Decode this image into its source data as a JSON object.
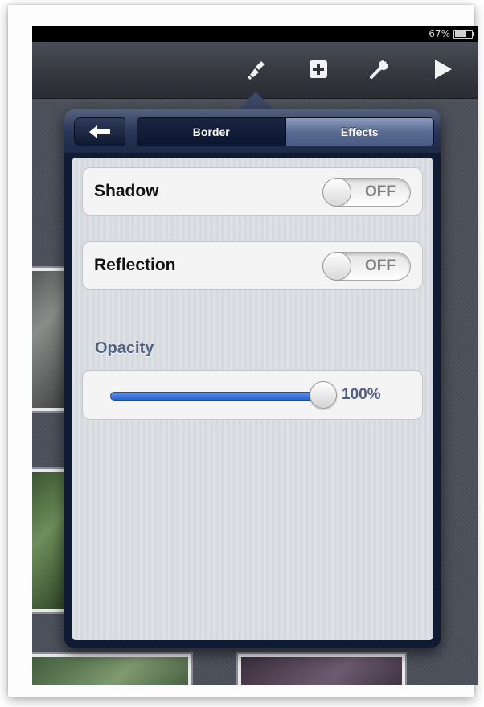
{
  "status_bar": {
    "battery_percent": "67%",
    "battery_level": 0.67
  },
  "toolbar": {
    "icons": [
      "paintbrush-icon",
      "add-icon",
      "wrench-icon",
      "play-icon"
    ]
  },
  "popover": {
    "tabs": [
      {
        "label": "Border",
        "selected": false
      },
      {
        "label": "Effects",
        "selected": true
      }
    ],
    "shadow": {
      "label": "Shadow",
      "state": "OFF"
    },
    "reflection": {
      "label": "Reflection",
      "state": "OFF"
    },
    "opacity": {
      "label": "Opacity",
      "value_text": "100%",
      "value": 1.0
    }
  },
  "colors": {
    "accent_blue": "#2a61d4",
    "section_label": "#4f6083",
    "popover_frame": "#0f1a33"
  }
}
